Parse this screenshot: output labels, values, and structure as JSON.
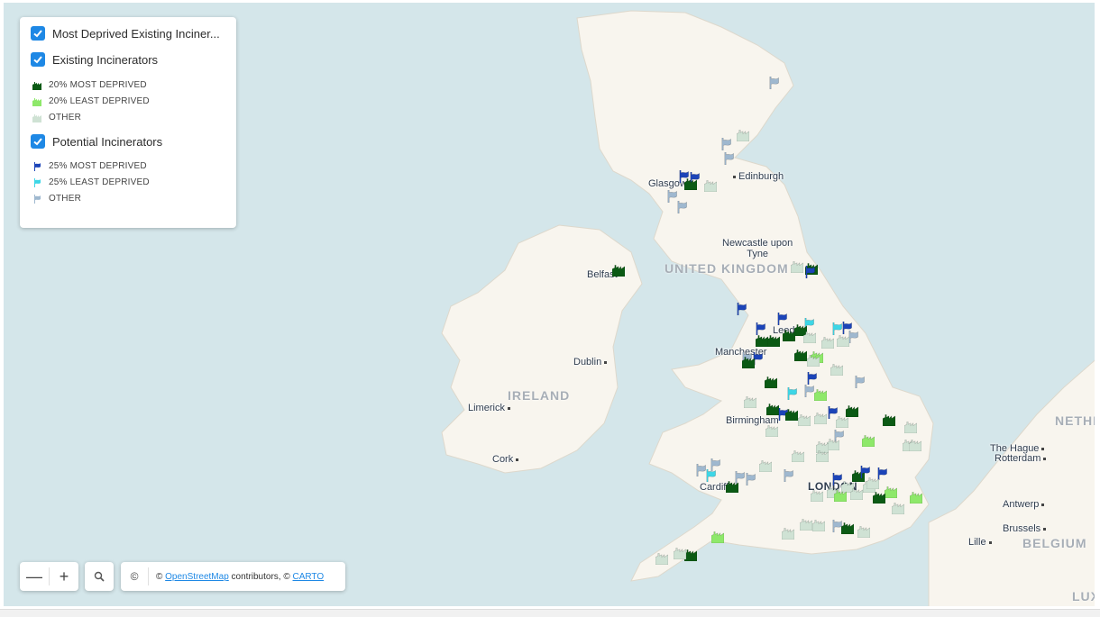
{
  "legend": {
    "layers": [
      {
        "label": "Most Deprived Existing Inciner...",
        "checked": true
      },
      {
        "label": "Existing Incinerators",
        "checked": true
      },
      {
        "label": "Potential Incinerators",
        "checked": true
      }
    ],
    "existing_items": [
      {
        "label": "20% MOST DEPRIVED",
        "color": "#0b5a14"
      },
      {
        "label": "20% LEAST DEPRIVED",
        "color": "#8ee86a"
      },
      {
        "label": "OTHER",
        "color": "#cfe2d4"
      }
    ],
    "potential_items": [
      {
        "label": "25% MOST DEPRIVED",
        "color": "#1c44b8"
      },
      {
        "label": "25% LEAST DEPRIVED",
        "color": "#3dd6e6"
      },
      {
        "label": "OTHER",
        "color": "#9fb8cf"
      }
    ]
  },
  "map": {
    "countries": {
      "uk": "UNITED KINGDOM",
      "ireland": "IRELAND",
      "belgium": "BELGIUM",
      "netherlands": "NETHE",
      "luxembourg": "LUX"
    },
    "places": {
      "glasgow": "Glasgow",
      "edinburgh": "Edinburgh",
      "newcastle_1": "Newcastle upon",
      "newcastle_2": "Tyne",
      "belfast": "Belfast",
      "leeds": "Leeds",
      "manchester": "Manchester",
      "dublin": "Dublin",
      "limerick": "Limerick",
      "cork": "Cork",
      "birmingham": "Birmingham",
      "cardiff": "Cardiff",
      "london": "LONDON",
      "the_hague": "The Hague",
      "rotterdam": "Rotterdam",
      "antwerp": "Antwerp",
      "brussels": "Brussels",
      "lille": "Lille"
    }
  },
  "controls": {
    "zoom_out": "—",
    "zoom_in": "+",
    "info": "©",
    "attribution_prefix": "©",
    "attribution_osm": "OpenStreetMap",
    "attribution_mid": "contributors, ©",
    "attribution_carto": "CARTO"
  }
}
